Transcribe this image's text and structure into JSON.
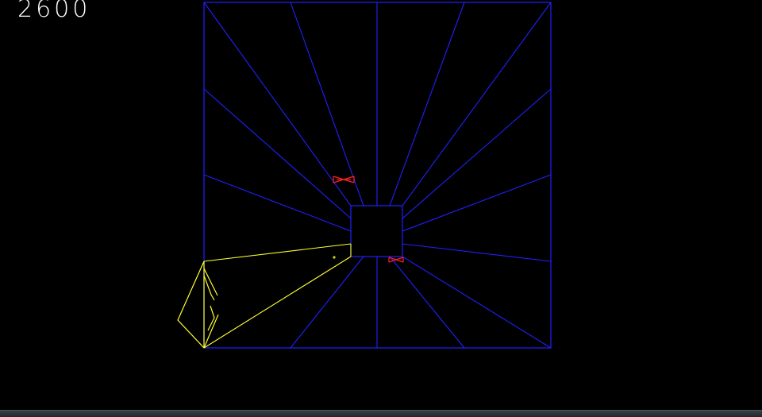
{
  "hud": {
    "score": "2600"
  },
  "colors": {
    "background": "#000000",
    "tube": "#2020ff",
    "player": "#ffff33",
    "enemy": "#ff2020",
    "score_text": "#ffffff"
  },
  "playfield": {
    "tube_shape": "square",
    "enemies": [
      {
        "type": "flipper",
        "color": "red"
      },
      {
        "type": "flipper",
        "color": "red"
      }
    ],
    "player": {
      "type": "claw-ship",
      "color": "yellow"
    },
    "projectile": {
      "type": "shot",
      "color": "yellow"
    }
  }
}
